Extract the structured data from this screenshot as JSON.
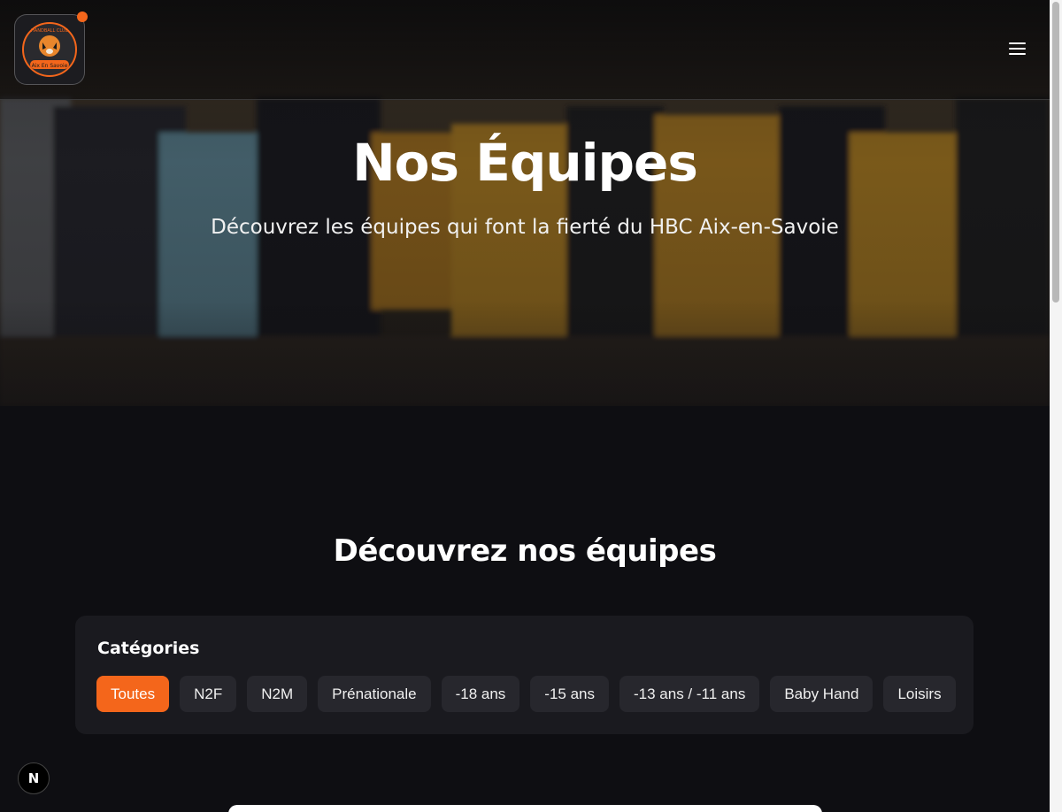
{
  "header": {
    "logo_alt": "HBC Aix-en-Savoie",
    "logo_text_top": "HANDBALL CLUB",
    "logo_text_bottom": "Aix En Savoie",
    "menu_icon": "hamburger-menu-icon"
  },
  "hero": {
    "title": "Nos Équipes",
    "subtitle": "Découvrez les équipes qui font la fierté du HBC Aix-en-Savoie"
  },
  "section": {
    "title": "Découvrez nos équipes",
    "filter_label": "Catégories",
    "categories": [
      {
        "label": "Toutes",
        "active": true
      },
      {
        "label": "N2F",
        "active": false
      },
      {
        "label": "N2M",
        "active": false
      },
      {
        "label": "Prénationale",
        "active": false
      },
      {
        "label": "-18 ans",
        "active": false
      },
      {
        "label": "-15 ans",
        "active": false
      },
      {
        "label": "-13 ans / -11 ans",
        "active": false
      },
      {
        "label": "Baby Hand",
        "active": false
      },
      {
        "label": "Loisirs",
        "active": false
      }
    ]
  },
  "devtools": {
    "badge": "N"
  },
  "colors": {
    "accent": "#f4661b",
    "background": "#0e0e12",
    "card": "#1a1a1f",
    "chip": "#27272d"
  }
}
